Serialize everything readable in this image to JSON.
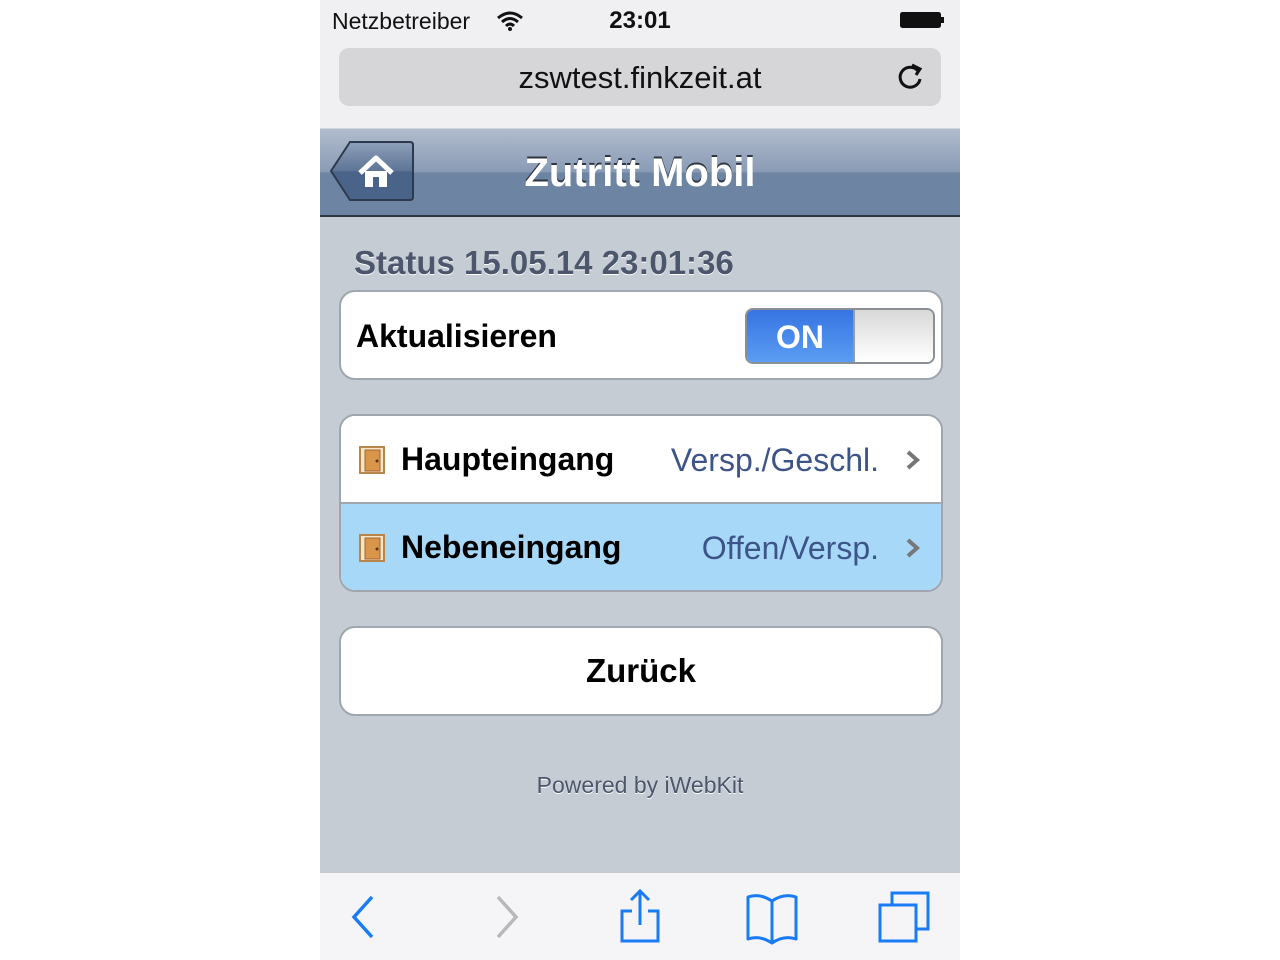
{
  "status_bar": {
    "carrier": "Netzbetreiber",
    "time": "23:01"
  },
  "browser": {
    "url": "zswtest.finkzeit.at"
  },
  "navbar": {
    "title": "Zutritt Mobil"
  },
  "page": {
    "status_label": "Status 15.05.14 23:01:36",
    "refresh_label": "Aktualisieren",
    "toggle_state": "ON",
    "doors": [
      {
        "name": "Haupteingang",
        "status": "Versp./Geschl.",
        "highlighted": false
      },
      {
        "name": "Nebeneingang",
        "status": "Offen/Versp.",
        "highlighted": true
      }
    ],
    "back_label": "Zurück",
    "footer": "Powered by iWebKit"
  },
  "colors": {
    "highlight_row": "#a8d8f8",
    "link_blue": "#1a7cf5",
    "status_text": "#3c5488"
  },
  "icons": {
    "toolbar": [
      "back-arrow-icon",
      "forward-arrow-icon",
      "share-icon",
      "bookmarks-icon",
      "tabs-icon"
    ]
  }
}
